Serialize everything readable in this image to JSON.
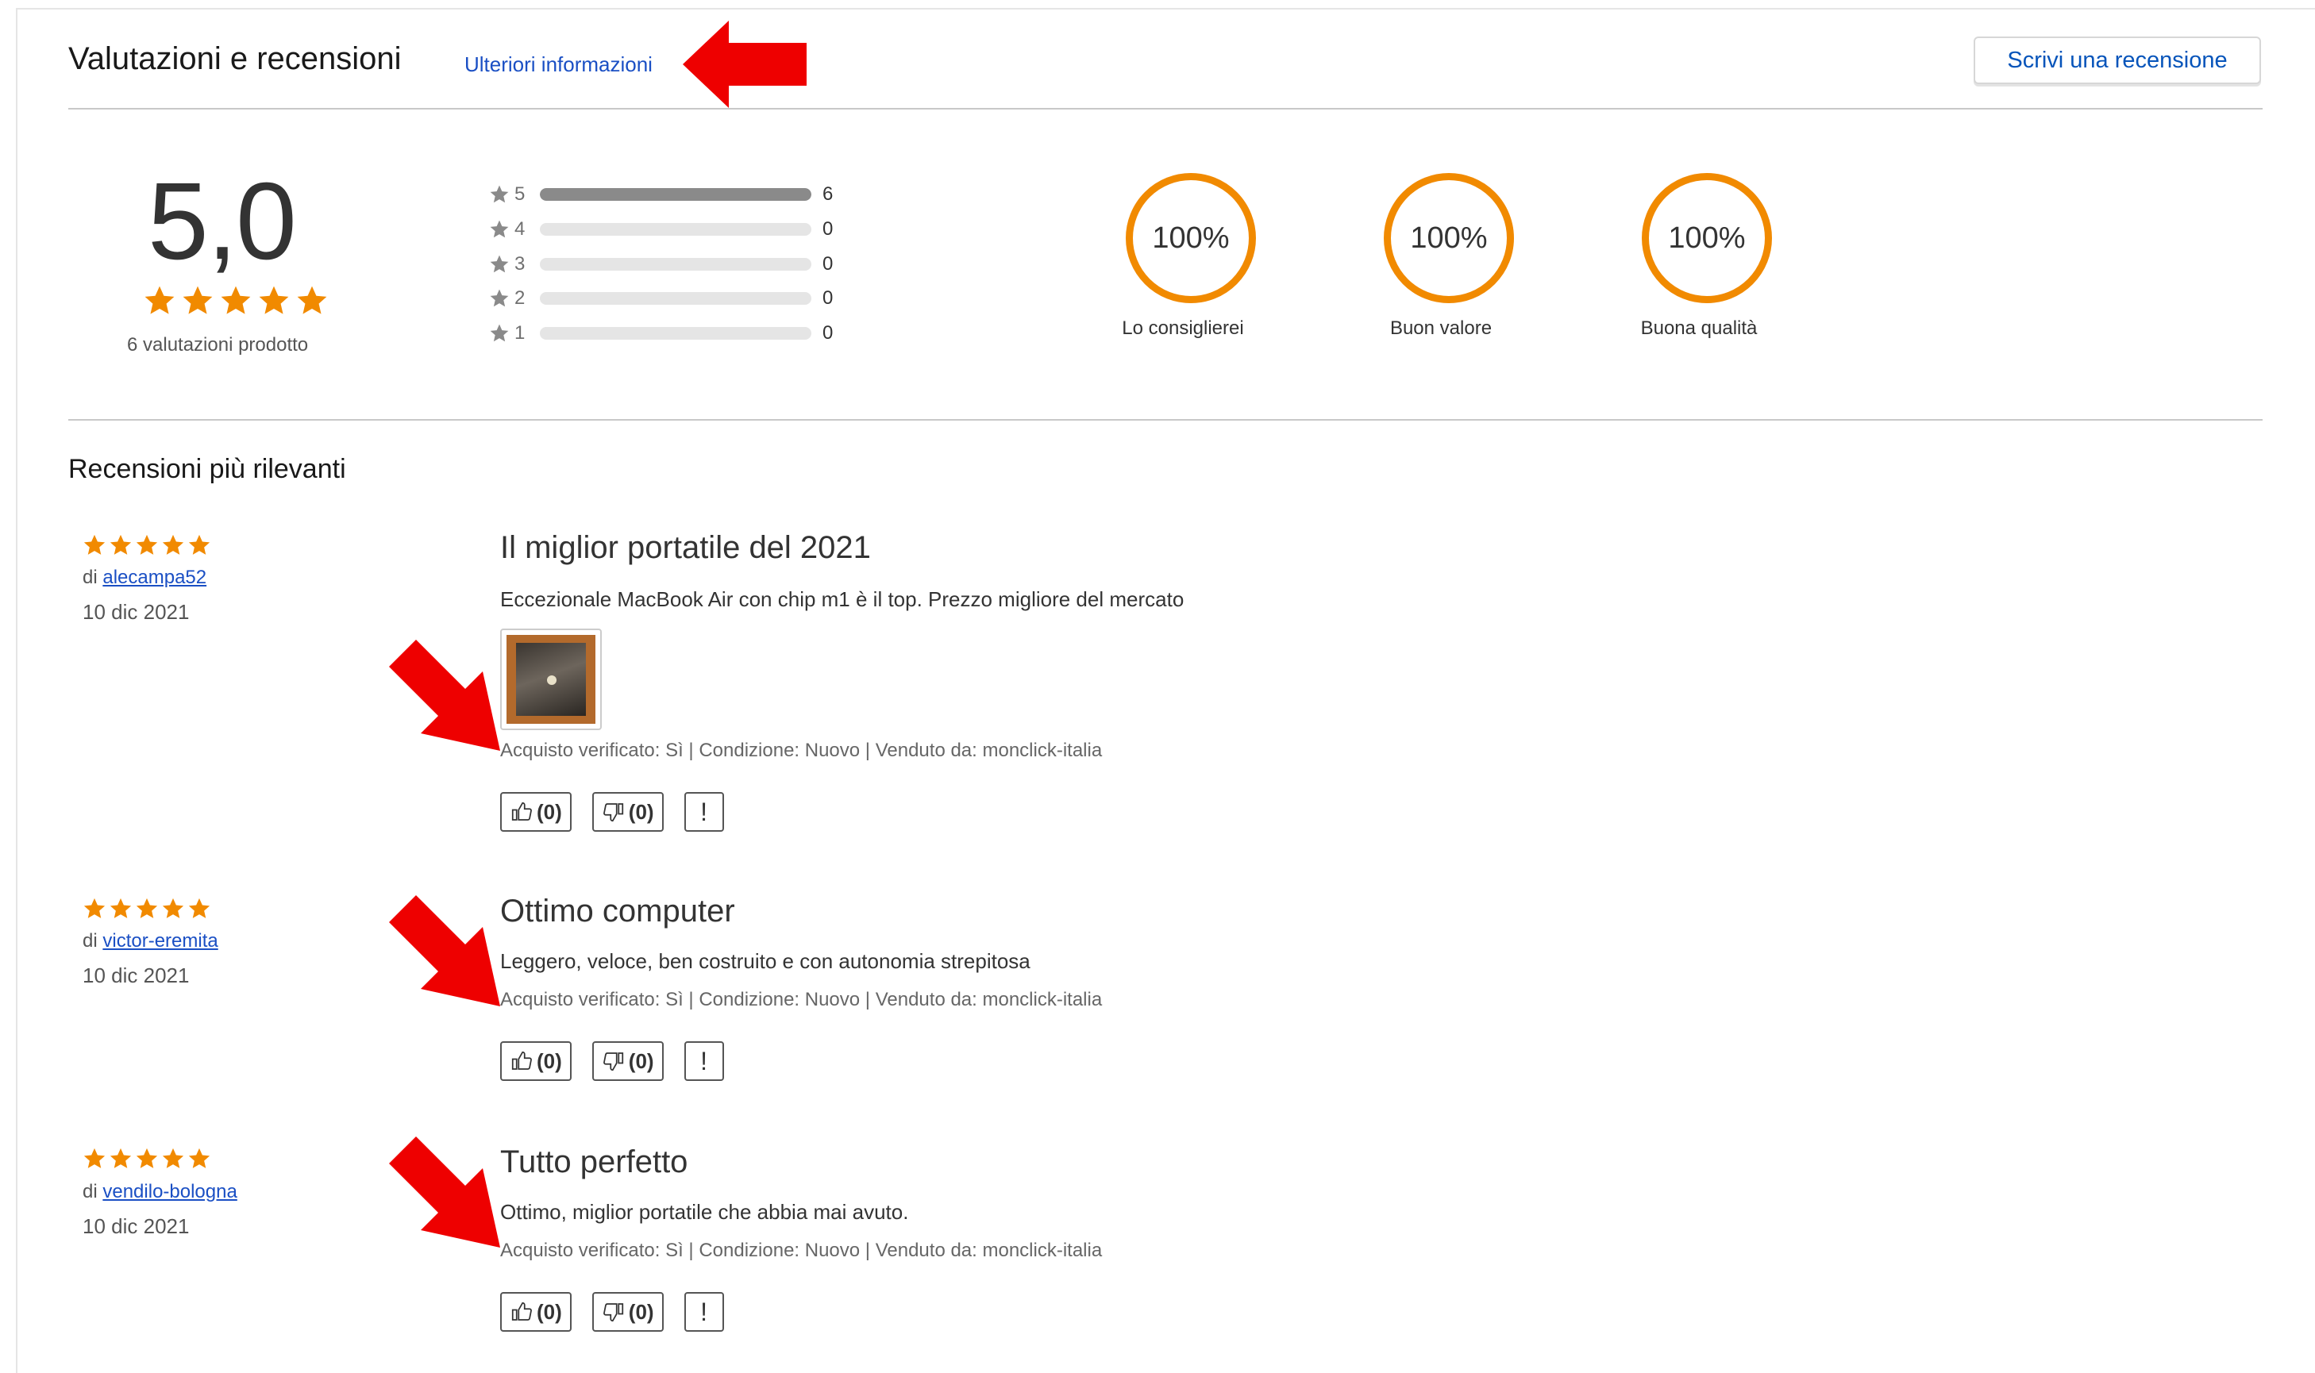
{
  "header": {
    "title": "Valutazioni e recensioni",
    "more_info": "Ulteriori informazioni",
    "write_review": "Scrivi una recensione"
  },
  "overall": {
    "score": "5,0",
    "stars": 5,
    "ratings_count": "6 valutazioni prodotto"
  },
  "histogram": [
    {
      "star": "5",
      "count": "6",
      "fraction": 1.0
    },
    {
      "star": "4",
      "count": "0",
      "fraction": 0
    },
    {
      "star": "3",
      "count": "0",
      "fraction": 0
    },
    {
      "star": "2",
      "count": "0",
      "fraction": 0
    },
    {
      "star": "1",
      "count": "0",
      "fraction": 0
    }
  ],
  "metrics": [
    {
      "value": "100%",
      "label": "Lo consiglierei"
    },
    {
      "value": "100%",
      "label": "Buon valore"
    },
    {
      "value": "100%",
      "label": "Buona qualità"
    }
  ],
  "relevant_title": "Recensioni più rilevanti",
  "reviews": [
    {
      "by_prefix": "di",
      "author": "alecampa52",
      "date": "10 dic 2021",
      "title": "Il miglior portatile del 2021",
      "body": "Eccezionale MacBook Air con chip m1 è il top. Prezzo migliore del mercato",
      "meta": "Acquisto verificato: Sì | Condizione: Nuovo | Venduto da: monclick-italia",
      "likes": "(0)",
      "dislikes": "(0)",
      "flag": "!"
    },
    {
      "by_prefix": "di",
      "author": "victor-eremita",
      "date": "10 dic 2021",
      "title": "Ottimo computer",
      "body": "Leggero, veloce, ben costruito e con autonomia strepitosa",
      "meta": "Acquisto verificato: Sì | Condizione: Nuovo | Venduto da: monclick-italia",
      "likes": "(0)",
      "dislikes": "(0)",
      "flag": "!"
    },
    {
      "by_prefix": "di",
      "author": "vendilo-bologna",
      "date": "10 dic 2021",
      "title": "Tutto perfetto",
      "body": "Ottimo, miglior portatile che abbia mai avuto.",
      "meta": "Acquisto verificato: Sì | Condizione: Nuovo | Venduto da: monclick-italia",
      "likes": "(0)",
      "dislikes": "(0)",
      "flag": "!"
    }
  ],
  "colors": {
    "star": "#f18a00",
    "link": "#1a4fc4",
    "annotation_arrow": "#ee0000"
  }
}
